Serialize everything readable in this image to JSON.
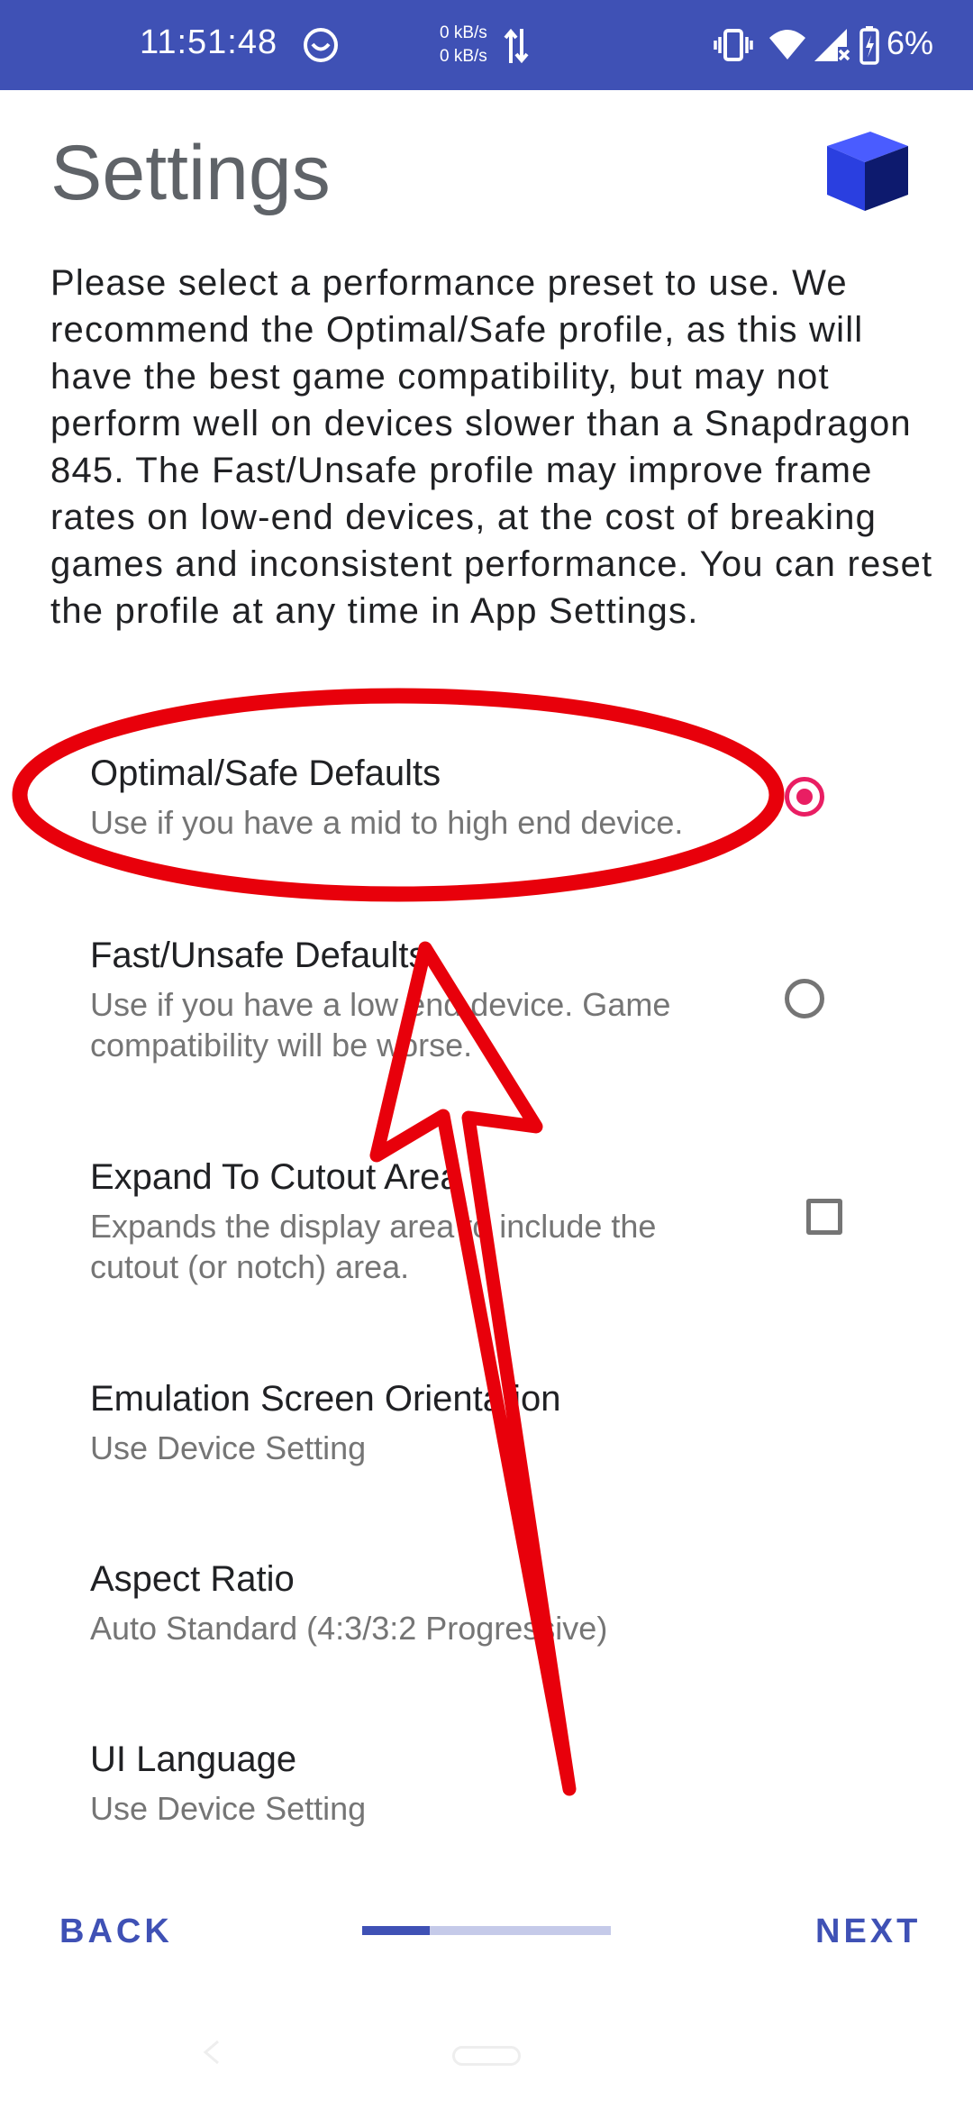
{
  "status_bar": {
    "time": "11:51:48",
    "net_up": "0 kB/s",
    "net_down": "0 kB/s",
    "battery_percent": "6%",
    "icons": [
      "app-notification-icon",
      "data-arrows-icon",
      "vibrate-icon",
      "wifi-icon",
      "signal-icon",
      "battery-charging-icon"
    ]
  },
  "header": {
    "title": "Settings",
    "logo_icon": "cube-logo-icon"
  },
  "description": "Please select a performance preset to use. We recommend the Optimal/Safe profile, as this will have the best game compatibility, but may not perform well on devices slower than a Snapdragon 845. The Fast/Unsafe profile may improve frame rates on low-end devices, at the cost of breaking games and inconsistent performance. You can reset the profile at any time in App Settings.",
  "settings": [
    {
      "title": "Optimal/Safe Defaults",
      "summary": "Use if you have a mid to high end device.",
      "control": "radio",
      "checked": true
    },
    {
      "title": "Fast/Unsafe Defaults",
      "summary": "Use if you have a low end device. Game compatibility will be worse.",
      "control": "radio",
      "checked": false
    },
    {
      "title": "Expand To Cutout Area",
      "summary": "Expands the display area to include the cutout (or notch) area.",
      "control": "checkbox",
      "checked": false
    },
    {
      "title": "Emulation Screen Orientation",
      "summary": "Use Device Setting"
    },
    {
      "title": "Aspect Ratio",
      "summary": "Auto Standard (4:3/3:2 Progressive)"
    },
    {
      "title": "UI Language",
      "summary": "Use Device Setting"
    }
  ],
  "nav": {
    "back_label": "BACK",
    "next_label": "NEXT",
    "progress": 0.27
  },
  "colors": {
    "status_bar": "#3f51b5",
    "accent": "#3f51b5",
    "radio_checked": "#e91e63",
    "annotation": "#e8000b"
  }
}
